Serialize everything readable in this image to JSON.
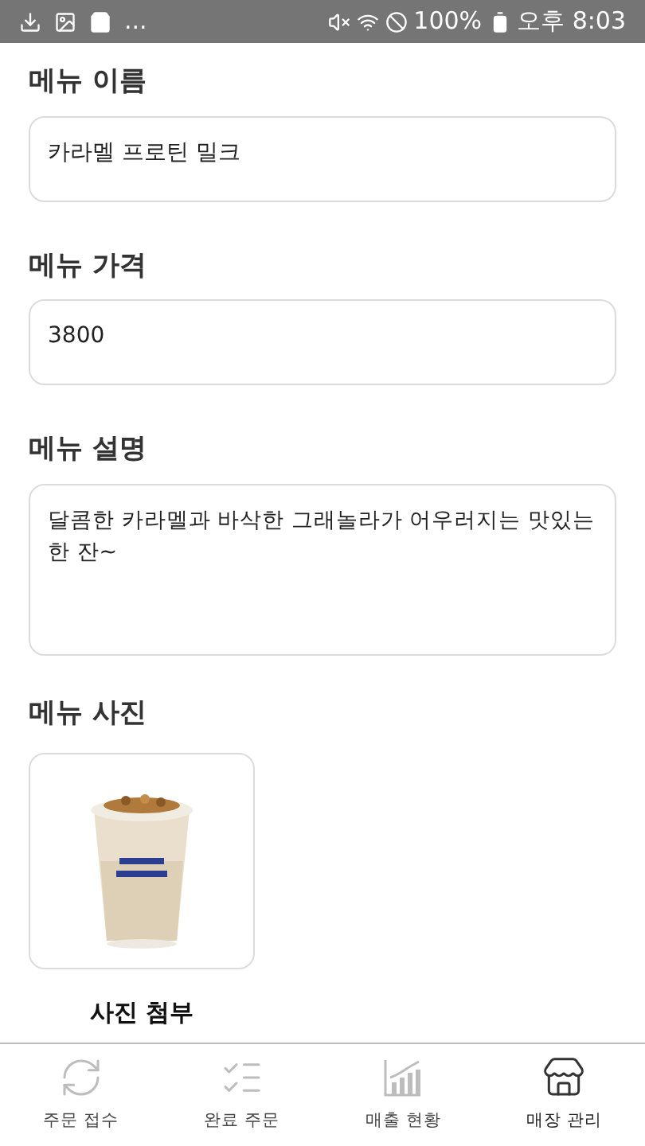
{
  "status_bar": {
    "overflow": "...",
    "battery": "100%",
    "time": "오후 8:03"
  },
  "fields": [
    {
      "label": "메뉴 이름",
      "value": "카라멜 프로틴 밀크",
      "kind": "input"
    },
    {
      "label": "메뉴 가격",
      "value": "3800",
      "kind": "input"
    },
    {
      "label": "메뉴 설명",
      "value": "달콤한 카라멜과 바삭한 그래놀라가 어우러지는 맛있는 한 잔~",
      "kind": "textarea"
    }
  ],
  "photo": {
    "label": "메뉴 사진",
    "attach": "사진 첨부"
  },
  "nav": [
    {
      "label": "주문 접수",
      "kind": "refresh",
      "selected": false
    },
    {
      "label": "완료 주문",
      "kind": "checklist",
      "selected": false
    },
    {
      "label": "매출 현황",
      "kind": "chart",
      "selected": false
    },
    {
      "label": "매장 관리",
      "kind": "store",
      "selected": true
    }
  ]
}
